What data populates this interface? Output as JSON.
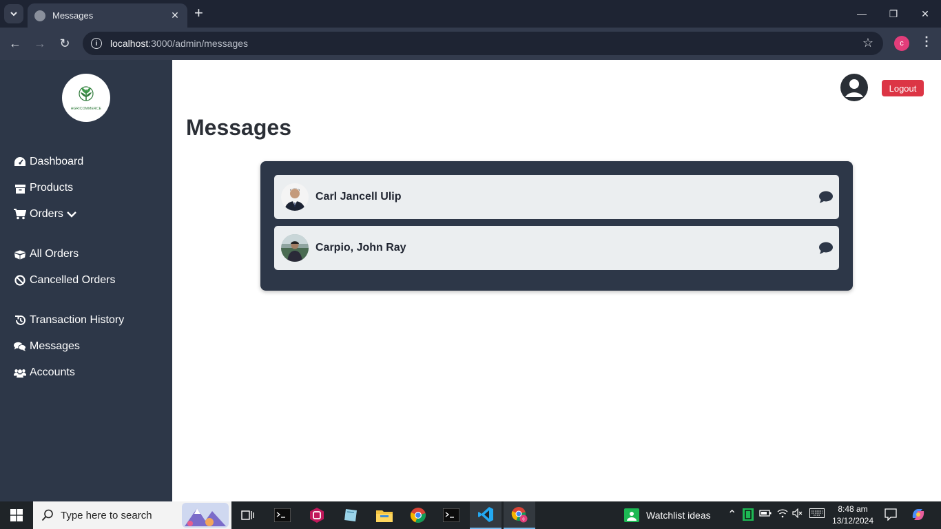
{
  "browser": {
    "tab_title": "Messages",
    "url_host": "localhost",
    "url_path": ":3000/admin/messages",
    "profile_initial": "c"
  },
  "sidebar": {
    "logo_text": "AGRICOMMERCE",
    "items": [
      {
        "label": "Dashboard",
        "icon": "gauge-icon"
      },
      {
        "label": "Products",
        "icon": "box-icon"
      },
      {
        "label": "Orders",
        "icon": "cart-icon",
        "has_dropdown": true
      },
      {
        "label": "All Orders",
        "icon": "boxes-icon"
      },
      {
        "label": "Cancelled Orders",
        "icon": "ban-icon"
      },
      {
        "label": "Transaction History",
        "icon": "history-icon"
      },
      {
        "label": "Messages",
        "icon": "comments-icon"
      },
      {
        "label": "Accounts",
        "icon": "users-icon"
      }
    ]
  },
  "header": {
    "logout_label": "Logout"
  },
  "main": {
    "title": "Messages",
    "conversations": [
      {
        "name": "Carl Jancell Ulip"
      },
      {
        "name": "Carpio, John Ray"
      }
    ]
  },
  "taskbar": {
    "search_placeholder": "Type here to search",
    "widget_text": "Watchlist ideas",
    "time": "8:48 am",
    "date": "13/12/2024"
  },
  "colors": {
    "sidebar_bg": "#2d3748",
    "logout_bg": "#dc3545",
    "panel_bg": "#2d3748",
    "row_bg": "#ebeef0"
  }
}
